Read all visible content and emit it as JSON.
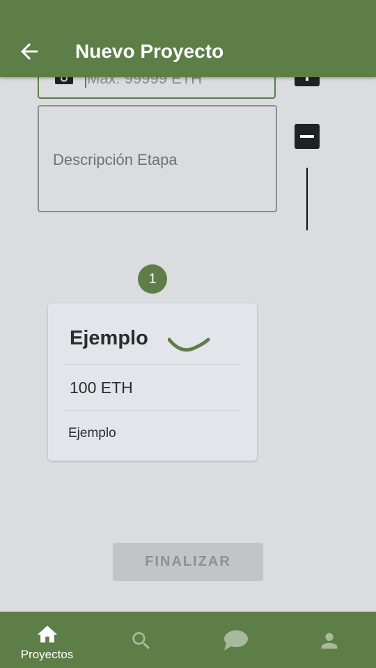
{
  "appbar": {
    "title": "Nuevo Proyecto",
    "back_icon": "arrow-left-icon"
  },
  "form": {
    "amount_placeholder": "Máx. 99999 ETH",
    "description_placeholder": "Descripción Etapa"
  },
  "timeline": {
    "step_number": "1"
  },
  "stage_card": {
    "title": "Ejemplo",
    "amount": "100 ETH",
    "description": "Ejemplo"
  },
  "actions": {
    "finish_label": "FINALIZAR"
  },
  "bottom_nav": {
    "items": [
      {
        "label": "Proyectos",
        "icon": "home-icon",
        "active": true
      },
      {
        "label": "",
        "icon": "search-icon",
        "active": false
      },
      {
        "label": "",
        "icon": "chat-icon",
        "active": false
      },
      {
        "label": "",
        "icon": "profile-icon",
        "active": false
      }
    ]
  },
  "colors": {
    "primary": "#5d7e47",
    "background": "#dadce0",
    "card": "#e4e5ea",
    "disabled_button": "#c3c4c8",
    "inactive_icon": "#a9b99e"
  }
}
